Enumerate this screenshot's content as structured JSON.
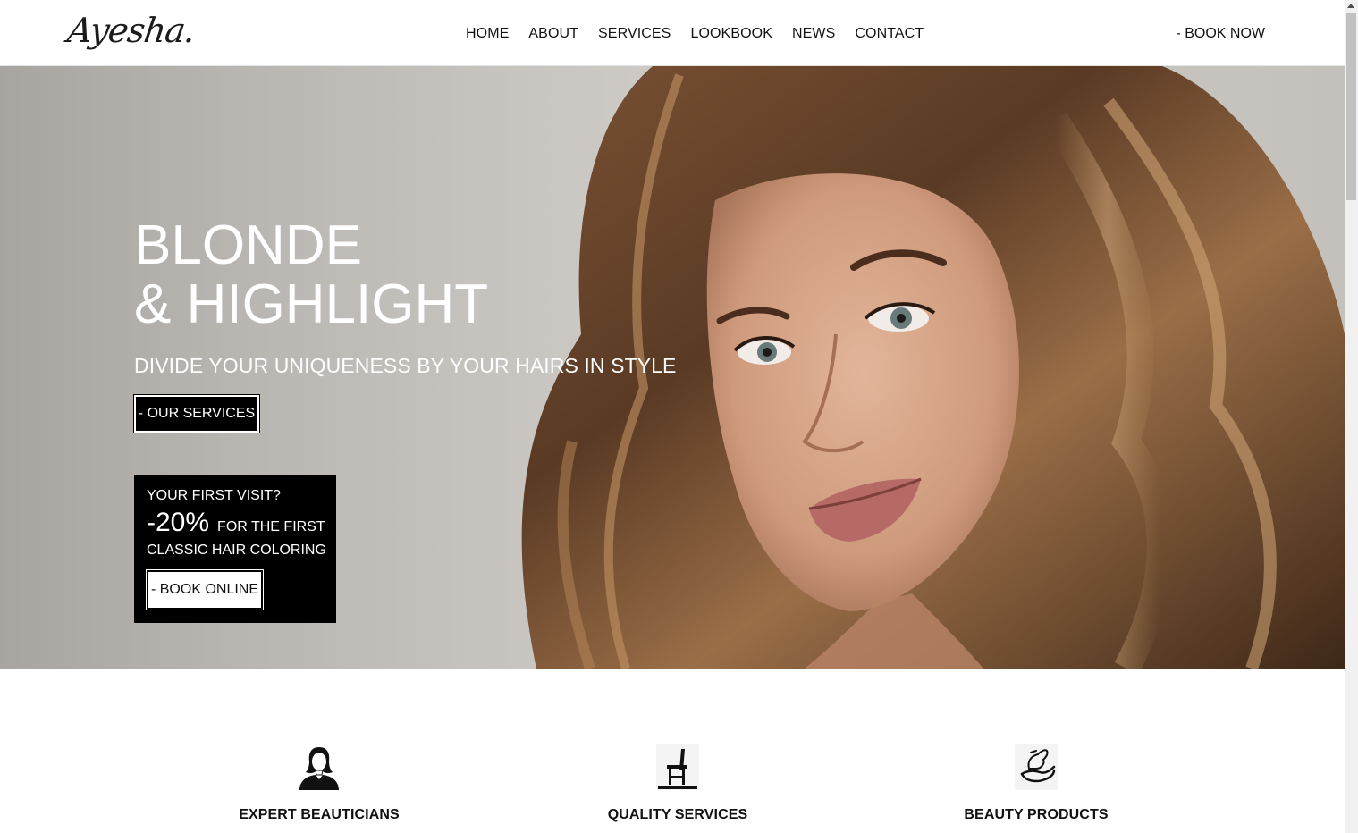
{
  "brand": {
    "logo_text": "Ayesha."
  },
  "nav": {
    "items": [
      {
        "label": "HOME"
      },
      {
        "label": "ABOUT"
      },
      {
        "label": "SERVICES"
      },
      {
        "label": "LOOKBOOK"
      },
      {
        "label": "NEWS"
      },
      {
        "label": "CONTACT"
      }
    ],
    "cta_label": "- BOOK NOW"
  },
  "hero": {
    "title_line1": "BLONDE",
    "title_line2": "& HIGHLIGHT",
    "subtitle": "DIVIDE YOUR UNIQUENESS BY YOUR HAIRS IN STYLE",
    "services_button": "- OUR SERVICES",
    "image_subject": "woman with long wavy brown hair"
  },
  "promo": {
    "question": "YOUR FIRST VISIT?",
    "discount": "-20%",
    "line1": "FOR THE FIRST",
    "line2": "CLASSIC HAIR COLORING",
    "button": "- BOOK ONLINE"
  },
  "features": [
    {
      "icon": "beautician-icon",
      "label": "EXPERT BEAUTICIANS"
    },
    {
      "icon": "salon-chair-icon",
      "label": "QUALITY SERVICES"
    },
    {
      "icon": "hand-product-icon",
      "label": "BEAUTY PRODUCTS"
    }
  ],
  "colors": {
    "text": "#111111",
    "background": "#ffffff",
    "promo_bg": "#000000",
    "hero_bg": "#c7c4c0"
  }
}
